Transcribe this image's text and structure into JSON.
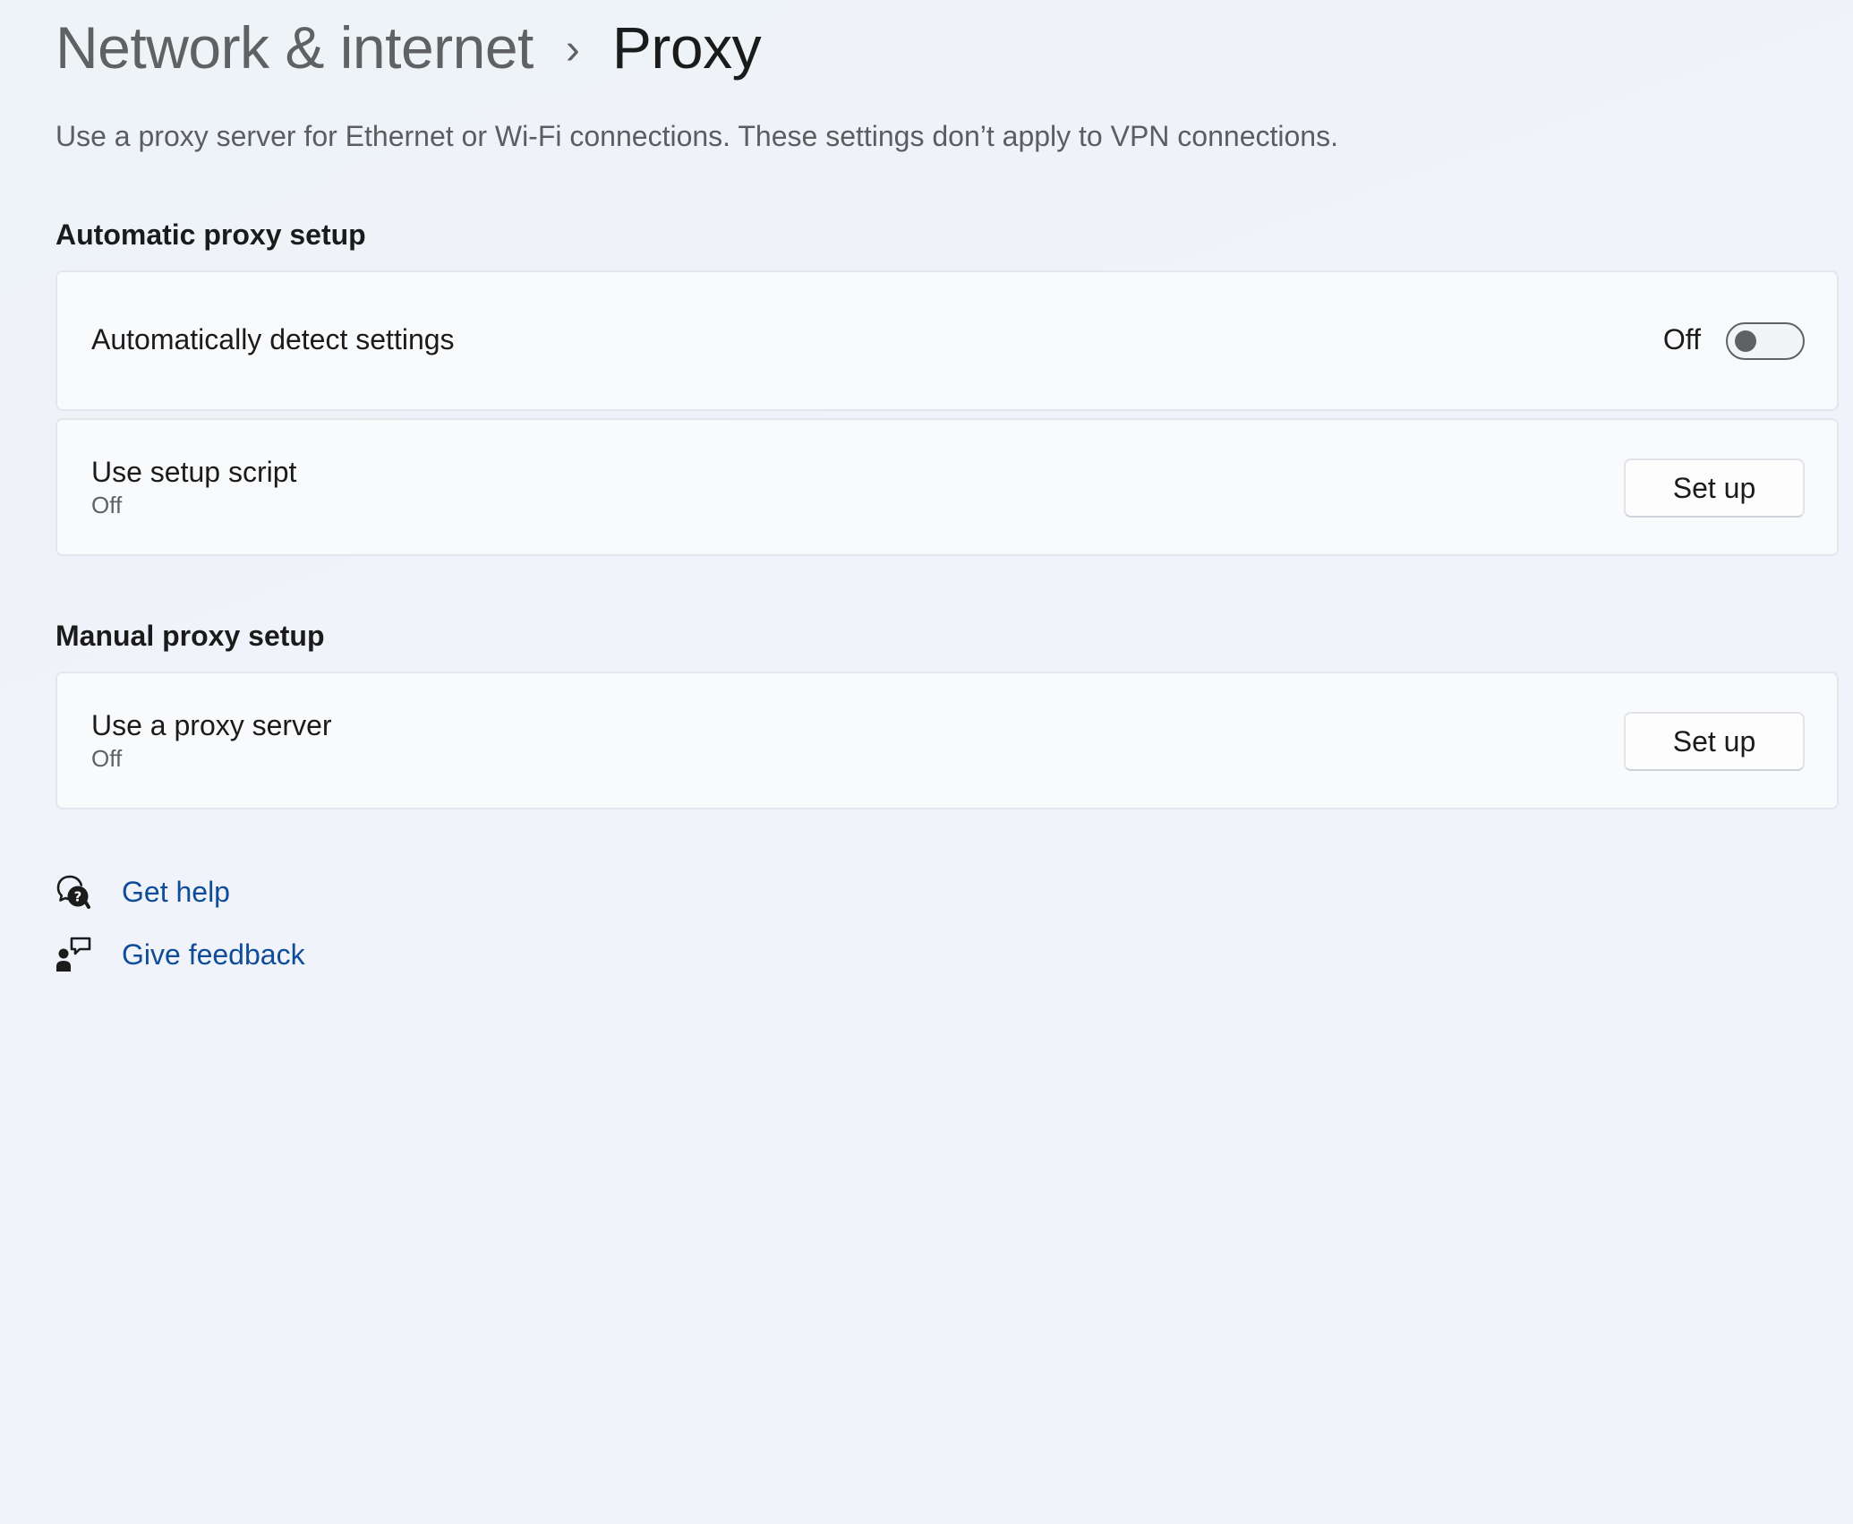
{
  "breadcrumb": {
    "parent": "Network & internet",
    "separator": "›",
    "current": "Proxy"
  },
  "description": "Use a proxy server for Ethernet or Wi-Fi connections. These settings don’t apply to VPN connections.",
  "automatic": {
    "title": "Automatic proxy setup",
    "detect": {
      "label": "Automatically detect settings",
      "state": "Off",
      "enabled": false
    },
    "script": {
      "label": "Use setup script",
      "status": "Off",
      "button": "Set up"
    }
  },
  "manual": {
    "title": "Manual proxy setup",
    "proxy": {
      "label": "Use a proxy server",
      "status": "Off",
      "button": "Set up"
    }
  },
  "links": {
    "help": {
      "label": "Get help",
      "icon": "get-help-icon"
    },
    "feedback": {
      "label": "Give feedback",
      "icon": "give-feedback-icon"
    }
  },
  "colors": {
    "link": "#0f4c9a",
    "toggle_off": "#5f6163",
    "card_background": "#f9fafc",
    "card_border": "#e3e6ec"
  }
}
